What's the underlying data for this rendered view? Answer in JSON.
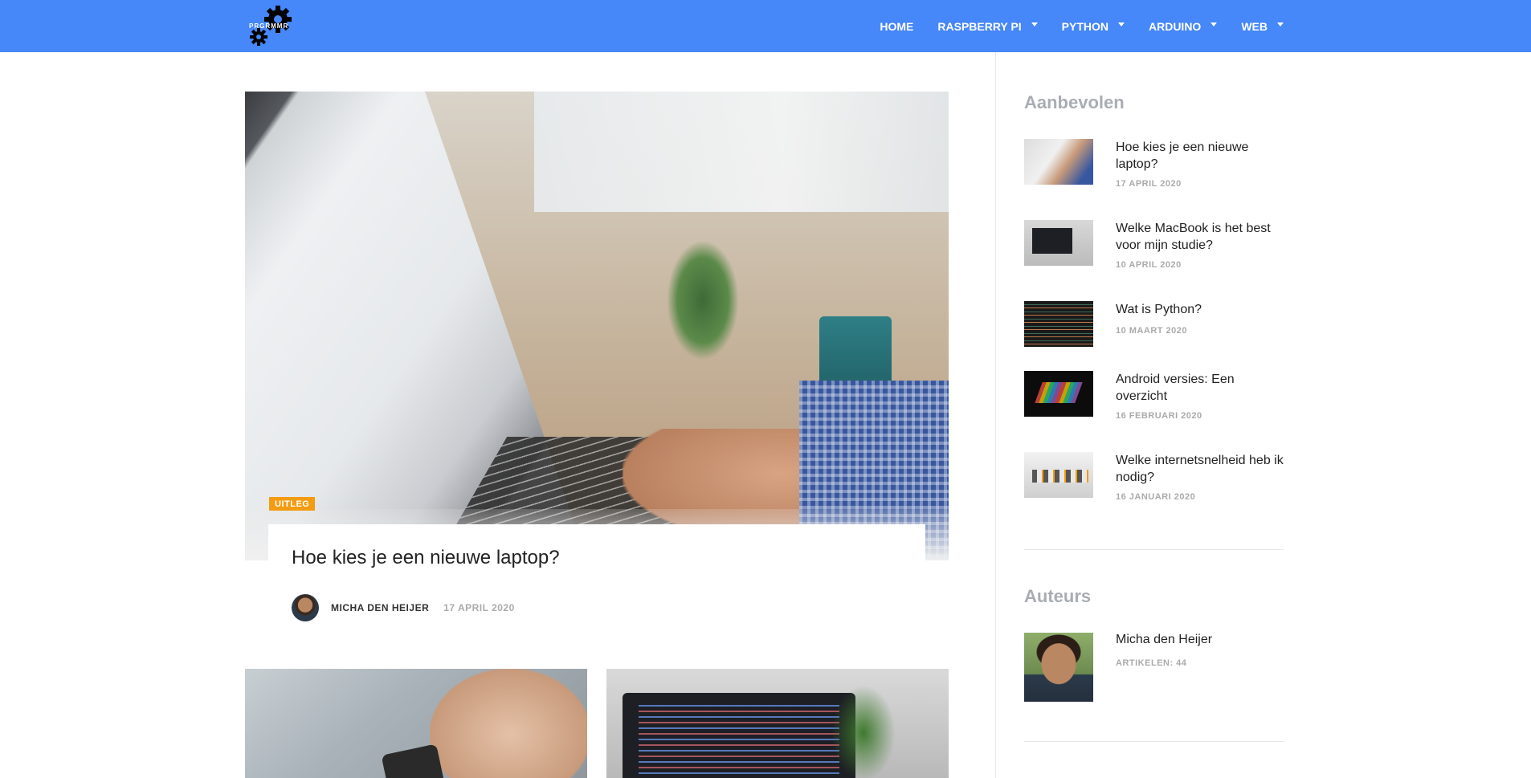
{
  "header": {
    "logo_text": "PRGRMMR",
    "nav": [
      {
        "label": "HOME",
        "has_dropdown": false
      },
      {
        "label": "RASPBERRY PI",
        "has_dropdown": true
      },
      {
        "label": "PYTHON",
        "has_dropdown": true
      },
      {
        "label": "ARDUINO",
        "has_dropdown": true
      },
      {
        "label": "WEB",
        "has_dropdown": true
      }
    ],
    "background_color": "#4687f9"
  },
  "featured_post": {
    "category": "UITLEG",
    "category_color": "#f39c12",
    "title": "Hoe kies je een nieuwe laptop?",
    "author": "MICHA DEN HEIJER",
    "date": "17 APRIL 2020"
  },
  "sidebar": {
    "recommended": {
      "title": "Aanbevolen",
      "posts": [
        {
          "title": "Hoe kies je een nieuwe laptop?",
          "date": "17 APRIL 2020"
        },
        {
          "title": "Welke MacBook is het best voor mijn studie?",
          "date": "10 APRIL 2020"
        },
        {
          "title": "Wat is Python?",
          "date": "10 MAART 2020"
        },
        {
          "title": "Android versies: Een overzicht",
          "date": "16 FEBRUARI 2020"
        },
        {
          "title": "Welke internetsnelheid heb ik nodig?",
          "date": "16 JANUARI 2020"
        }
      ]
    },
    "authors": {
      "title": "Auteurs",
      "items": [
        {
          "name": "Micha den Heijer",
          "articles": "ARTIKELEN: 44"
        }
      ]
    }
  }
}
